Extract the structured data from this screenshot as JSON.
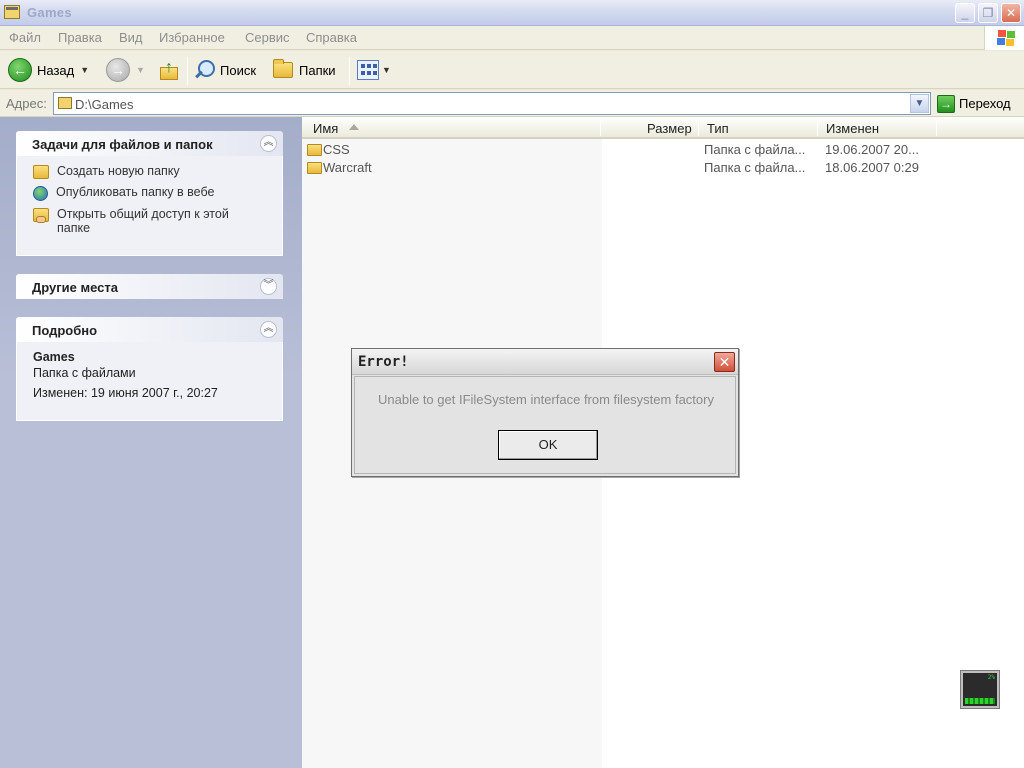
{
  "window": {
    "title": "Games"
  },
  "menu": [
    "Файл",
    "Правка",
    "Вид",
    "Избранное",
    "Сервис",
    "Справка"
  ],
  "toolbar": {
    "back_label": "Назад",
    "search_label": "Поиск",
    "folders_label": "Папки"
  },
  "address": {
    "label": "Адрес:",
    "value": "D:\\Games",
    "go_label": "Переход"
  },
  "tasks_panel": {
    "title": "Задачи для файлов и папок",
    "items": [
      {
        "label": "Создать новую папку",
        "icon": "new-folder-icon"
      },
      {
        "label": "Опубликовать папку в вебе",
        "icon": "web-publish-icon"
      },
      {
        "label": "Открыть общий доступ к этой папке",
        "icon": "share-folder-icon"
      }
    ]
  },
  "other_places": {
    "title": "Другие места"
  },
  "details": {
    "title": "Подробно",
    "name": "Games",
    "type": "Папка с файлами",
    "modified": "Изменен: 19 июня 2007 г., 20:27"
  },
  "columns": {
    "name": "Имя",
    "size": "Размер",
    "type": "Тип",
    "modified": "Изменен"
  },
  "files": [
    {
      "name": "CSS",
      "size": "",
      "type": "Папка с файла...",
      "modified": "19.06.2007 20..."
    },
    {
      "name": "Warcraft",
      "size": "",
      "type": "Папка с файла...",
      "modified": "18.06.2007 0:29"
    }
  ],
  "dialog": {
    "title": "Error!",
    "message": "Unable to get IFileSystem interface from filesystem factory",
    "ok_label": "OK"
  },
  "tray": {
    "value": "2%"
  }
}
